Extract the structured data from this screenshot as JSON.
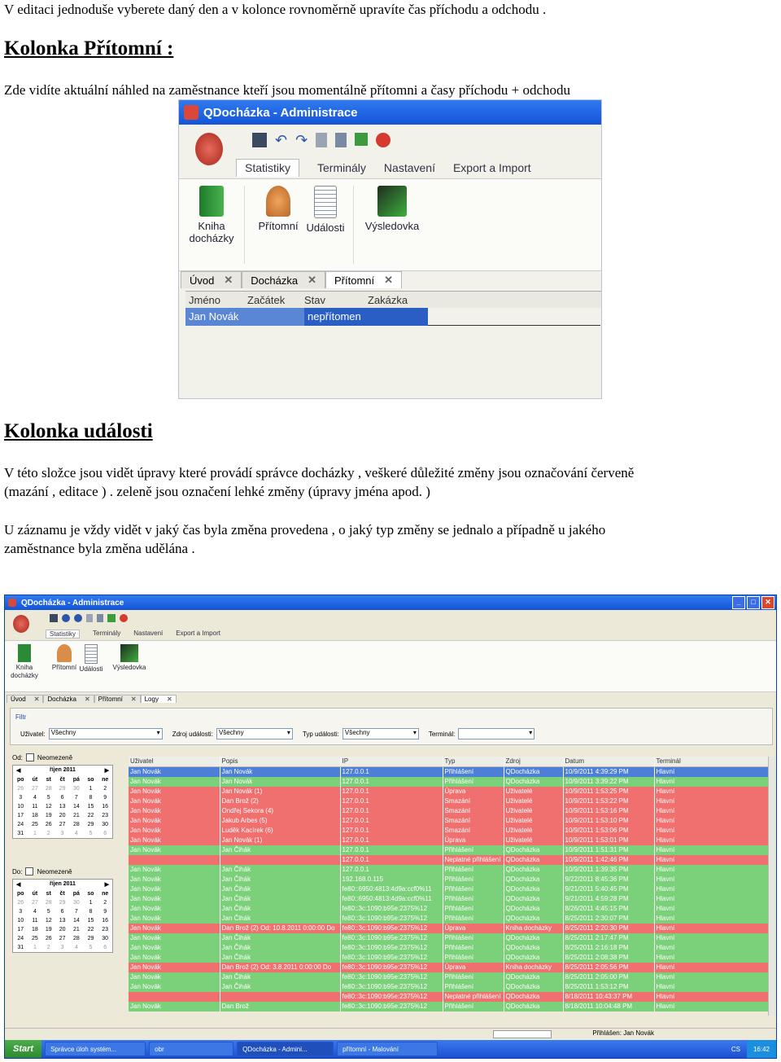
{
  "text": {
    "line1": "V editaci jednoduše vyberete daný den a v kolonce rovnoměrně upravíte čas příchodu a odchodu .",
    "h1": "Kolonka Přítomní :",
    "p1": "Zde vidíte aktuální náhled na zaměstnance kteří jsou momentálně přítomni a časy příchodu + odchodu",
    "h2": "Kolonka události",
    "p2a": "V této složce jsou vidět úpravy které provádí správce docházky , veškeré důležité změny jsou označování červeně",
    "p2b": "(mazání , editace ) . zeleně jsou označení lehké změny (úpravy jména apod. )",
    "p3a": "U záznamu je vždy vidět v jaký čas byla změna provedena , o jaký typ změny se jednalo a případně u jakého",
    "p3b": "zaměstnance byla změna udělána ."
  },
  "shot1": {
    "title": "QDocházka  -  Administrace",
    "ribbon_tabs": [
      "Statistiky",
      "Terminály",
      "Nastavení",
      "Export a Import"
    ],
    "buttons": [
      {
        "label": "Kniha\ndocházky",
        "icon": "book-icon"
      },
      {
        "label": "Přítomní",
        "icon": "people-icon"
      },
      {
        "label": "Události",
        "icon": "notepad-icon"
      },
      {
        "label": "Výsledovka",
        "icon": "chart-icon"
      }
    ],
    "doc_tabs": [
      "Úvod",
      "Docházka",
      "Přítomní"
    ],
    "columns": [
      "Jméno",
      "Začátek",
      "Stav",
      "Zakázka"
    ],
    "row": {
      "name": "Jan Novák",
      "start": "",
      "state": "nepřítomen",
      "order": ""
    }
  },
  "shot2": {
    "title": "QDocházka  -  Administrace",
    "ribbon_tabs": [
      "Statistiky",
      "Terminály",
      "Nastavení",
      "Export a Import"
    ],
    "buttons": [
      "Kniha\ndocházky",
      "Přítomní",
      "Události",
      "Výsledovka"
    ],
    "doc_tabs": [
      "Úvod",
      "Docházka",
      "Přítomní",
      "Logy"
    ],
    "filter_label": "Filtr",
    "filters": {
      "user_label": "Uživatel:",
      "user_value": "Všechny",
      "source_label": "Zdroj události:",
      "source_value": "Všechny",
      "type_label": "Typ události:",
      "type_value": "Všechny",
      "terminal_label": "Terminál:",
      "terminal_value": ""
    },
    "from_label": "Od:",
    "to_label": "Do:",
    "unlimited": "Neomezeně",
    "calendar_month": "říjen 2011",
    "calendar_days": [
      "po",
      "út",
      "st",
      "čt",
      "pá",
      "so",
      "ne"
    ],
    "cal_from": [
      [
        "26",
        "27",
        "28",
        "29",
        "30",
        "1",
        "2"
      ],
      [
        "3",
        "4",
        "5",
        "6",
        "7",
        "8",
        "9"
      ],
      [
        "10",
        "11",
        "12",
        "13",
        "14",
        "15",
        "16"
      ],
      [
        "17",
        "18",
        "19",
        "20",
        "21",
        "22",
        "23"
      ],
      [
        "24",
        "25",
        "26",
        "27",
        "28",
        "29",
        "30"
      ],
      [
        "31",
        "1",
        "2",
        "3",
        "4",
        "5",
        "6"
      ]
    ],
    "cal_to": [
      [
        "26",
        "27",
        "28",
        "29",
        "30",
        "1",
        "2"
      ],
      [
        "3",
        "4",
        "5",
        "6",
        "7",
        "8",
        "9"
      ],
      [
        "10",
        "11",
        "12",
        "13",
        "14",
        "15",
        "16"
      ],
      [
        "17",
        "18",
        "19",
        "20",
        "21",
        "22",
        "23"
      ],
      [
        "24",
        "25",
        "26",
        "27",
        "28",
        "29",
        "30"
      ],
      [
        "31",
        "1",
        "2",
        "3",
        "4",
        "5",
        "6"
      ]
    ],
    "columns": [
      "Uživatel",
      "Popis",
      "IP",
      "Typ",
      "Zdroj",
      "Datum",
      "Terminál"
    ],
    "rows": [
      {
        "c": "sel",
        "v": [
          "Jan Novák",
          "Jan Novák",
          "127.0.0.1",
          "Přihlášení",
          "QDocházka",
          "10/9/2011 4:39:29 PM",
          "Hlavní"
        ]
      },
      {
        "c": "green",
        "v": [
          "Jan Novák",
          "Jan Novák",
          "127.0.0.1",
          "Přihlášení",
          "QDocházka",
          "10/9/2011 3:39:22 PM",
          "Hlavní"
        ]
      },
      {
        "c": "red",
        "v": [
          "Jan Novák",
          "Jan Novák (1)",
          "127.0.0.1",
          "Úprava",
          "Uživatelé",
          "10/9/2011 1:53:25 PM",
          "Hlavní"
        ]
      },
      {
        "c": "red",
        "v": [
          "Jan Novák",
          "Dan Brož (2)",
          "127.0.0.1",
          "Smazání",
          "Uživatelé",
          "10/9/2011 1:53:22 PM",
          "Hlavní"
        ]
      },
      {
        "c": "red",
        "v": [
          "Jan Novák",
          "Ondřej Sekora (4)",
          "127.0.0.1",
          "Smazání",
          "Uživatelé",
          "10/9/2011 1:53:16 PM",
          "Hlavní"
        ]
      },
      {
        "c": "red",
        "v": [
          "Jan Novák",
          "Jakub Arbes (5)",
          "127.0.0.1",
          "Smazání",
          "Uživatelé",
          "10/9/2011 1:53:10 PM",
          "Hlavní"
        ]
      },
      {
        "c": "red",
        "v": [
          "Jan Novák",
          "Luděk Kacírek (6)",
          "127.0.0.1",
          "Smazání",
          "Uživatelé",
          "10/9/2011 1:53:06 PM",
          "Hlavní"
        ]
      },
      {
        "c": "red",
        "v": [
          "Jan Novák",
          "Jan Novák (1)",
          "127.0.0.1",
          "Úprava",
          "Uživatelé",
          "10/9/2011 1:53:01 PM",
          "Hlavní"
        ]
      },
      {
        "c": "green",
        "v": [
          "Jan Novák",
          "Jan Čihák",
          "127.0.0.1",
          "Přihlášení",
          "QDocházka",
          "10/9/2011 1:51:31 PM",
          "Hlavní"
        ]
      },
      {
        "c": "red",
        "v": [
          "",
          "",
          "127.0.0.1",
          "Neplatné přihlášení",
          "QDocházka",
          "10/9/2011 1:42:46 PM",
          "Hlavní"
        ]
      },
      {
        "c": "green",
        "v": [
          "Jan Novák",
          "Jan Čihák",
          "127.0.0.1",
          "Přihlášení",
          "QDocházka",
          "10/9/2011 1:39:35 PM",
          "Hlavní"
        ]
      },
      {
        "c": "green",
        "v": [
          "Jan Novák",
          "Jan Čihák",
          "192.168.0.115",
          "Přihlášení",
          "QDocházka",
          "9/22/2011 8:45:36 PM",
          "Hlavní"
        ]
      },
      {
        "c": "green",
        "v": [
          "Jan Novák",
          "Jan Čihák",
          "fe80::6950:4813:4d9a:ccf0%11",
          "Přihlášení",
          "QDocházka",
          "9/21/2011 5:40:45 PM",
          "Hlavní"
        ]
      },
      {
        "c": "green",
        "v": [
          "Jan Novák",
          "Jan Čihák",
          "fe80::6950:4813:4d9a:ccf0%11",
          "Přihlášení",
          "QDocházka",
          "9/21/2011 4:59:28 PM",
          "Hlavní"
        ]
      },
      {
        "c": "green",
        "v": [
          "Jan Novák",
          "Jan Čihák",
          "fe80::3c:1090:b95e:2375%12",
          "Přihlášení",
          "QDocházka",
          "8/26/2011 4:45:15 PM",
          "Hlavní"
        ]
      },
      {
        "c": "green",
        "v": [
          "Jan Novák",
          "Jan Čihák",
          "fe80::3c:1090:b95e:2375%12",
          "Přihlášení",
          "QDocházka",
          "8/25/2011 2:30:07 PM",
          "Hlavní"
        ]
      },
      {
        "c": "red",
        "v": [
          "Jan Novák",
          "Dan Brož (2) Od: 10.8.2011 0:00:00 Do",
          "fe80::3c:1090:b95e:2375%12",
          "Úprava",
          "Kniha docházky",
          "8/25/2011 2:20:30 PM",
          "Hlavní"
        ]
      },
      {
        "c": "green",
        "v": [
          "Jan Novák",
          "Jan Čihák",
          "fe80::3c:1090:b95e:2375%12",
          "Přihlášení",
          "QDocházka",
          "8/25/2011 2:17:47 PM",
          "Hlavní"
        ]
      },
      {
        "c": "green",
        "v": [
          "Jan Novák",
          "Jan Čihák",
          "fe80::3c:1090:b95e:2375%12",
          "Přihlášení",
          "QDocházka",
          "8/25/2011 2:16:18 PM",
          "Hlavní"
        ]
      },
      {
        "c": "green",
        "v": [
          "Jan Novák",
          "Jan Čihák",
          "fe80::3c:1090:b95e:2375%12",
          "Přihlášení",
          "QDocházka",
          "8/25/2011 2:08:38 PM",
          "Hlavní"
        ]
      },
      {
        "c": "red",
        "v": [
          "Jan Novák",
          "Dan Brož (2) Od: 3.8.2011 0:00:00 Do",
          "fe80::3c:1090:b95e:2375%12",
          "Úprava",
          "Kniha docházky",
          "8/25/2011 2:05:56 PM",
          "Hlavní"
        ]
      },
      {
        "c": "green",
        "v": [
          "Jan Novák",
          "Jan Čihák",
          "fe80::3c:1090:b95e:2375%12",
          "Přihlášení",
          "QDocházka",
          "8/25/2011 2:05:00 PM",
          "Hlavní"
        ]
      },
      {
        "c": "green",
        "v": [
          "Jan Novák",
          "Jan Čihák",
          "fe80::3c:1090:b95e:2375%12",
          "Přihlášení",
          "QDocházka",
          "8/25/2011 1:53:12 PM",
          "Hlavní"
        ]
      },
      {
        "c": "red",
        "v": [
          "",
          "",
          "fe80::3c:1090:b95e:2375%12",
          "Neplatné přihlášení",
          "QDocházka",
          "8/18/2011 10:43:37 PM",
          "Hlavní"
        ]
      },
      {
        "c": "green",
        "v": [
          "Jan Novák",
          "Dan Brož",
          "fe80::3c:1090:b95e:2375%12",
          "Přihlášení",
          "QDocházka",
          "8/18/2011 10:04:48 PM",
          "Hlavní"
        ]
      }
    ],
    "status": "Přihlášen: Jan Novák",
    "taskbar": {
      "start": "Start",
      "items": [
        "Správce úloh systém...",
        "obr",
        "QDocházka  -  Admini...",
        "přítomní - Malování"
      ],
      "lang": "CS",
      "clock": "16:42"
    },
    "colors": {
      "red": "#f06f6f",
      "green": "#7bd07a",
      "selected": "#4d7fd6",
      "title": "#1454d8"
    }
  }
}
